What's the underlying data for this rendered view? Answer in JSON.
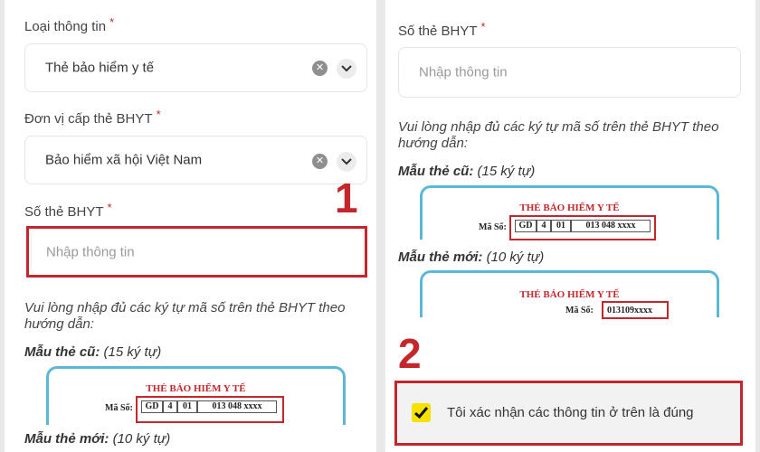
{
  "form": {
    "info_type_label": "Loại thông tin",
    "info_type_value": "Thẻ bảo hiểm y tế",
    "issuer_label": "Đơn vị cấp thẻ BHYT",
    "issuer_value": "Bảo hiểm xã hội Việt Nam",
    "card_number_label": "Số thẻ BHYT",
    "card_number_placeholder": "Nhập thông tin",
    "required_mark": "*",
    "hint": "Vui lòng nhập đủ các ký tự mã số trên thẻ BHYT theo hướng dẫn:",
    "old_sample_label": "Mẫu thẻ cũ:",
    "old_sample_note": "(15 ký tự)",
    "new_sample_label": "Mẫu thẻ mới:",
    "new_sample_note": "(10 ký tự)",
    "confirm_text": "Tôi xác nhận các thông tin ở trên là đúng"
  },
  "card": {
    "title": "THẺ BẢO HIỂM Y TẾ",
    "code_label": "Mã Số:",
    "old_code_parts": [
      "GD",
      "4",
      "01",
      "013 048 xxxx"
    ],
    "new_code": "013109xxxx"
  },
  "annotations": {
    "step1": "1",
    "step2": "2"
  },
  "colors": {
    "highlight": "#c3272b",
    "checkbox": "#f7e100",
    "card_border": "#5ab8d9"
  }
}
